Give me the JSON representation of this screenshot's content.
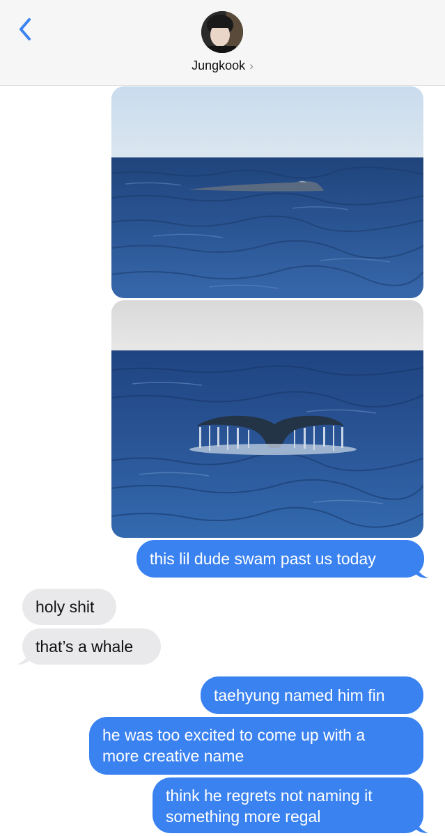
{
  "header": {
    "back_icon": "chevron-left-icon",
    "contact_name": "Jungkook",
    "contact_chevron": "›",
    "accent_color": "#3b82f1"
  },
  "messages": [
    {
      "type": "image",
      "direction": "outgoing",
      "description_icon": "whale-surfacing-photo"
    },
    {
      "type": "image",
      "direction": "outgoing",
      "description_icon": "whale-tail-photo"
    },
    {
      "type": "text",
      "direction": "outgoing",
      "text": "this lil dude swam past us today"
    },
    {
      "type": "text",
      "direction": "incoming",
      "text": "holy shit"
    },
    {
      "type": "text",
      "direction": "incoming",
      "text": "that’s a whale"
    },
    {
      "type": "text",
      "direction": "outgoing",
      "text": "taehyung named him fin"
    },
    {
      "type": "text",
      "direction": "outgoing",
      "lines": [
        "he was too excited to come up with a",
        "more creative name"
      ]
    },
    {
      "type": "text",
      "direction": "outgoing",
      "lines": [
        "think he regrets not naming it",
        "something more regal"
      ]
    }
  ],
  "colors": {
    "outgoing_bubble": "#3b82f1",
    "incoming_bubble": "#e9e9eb"
  }
}
